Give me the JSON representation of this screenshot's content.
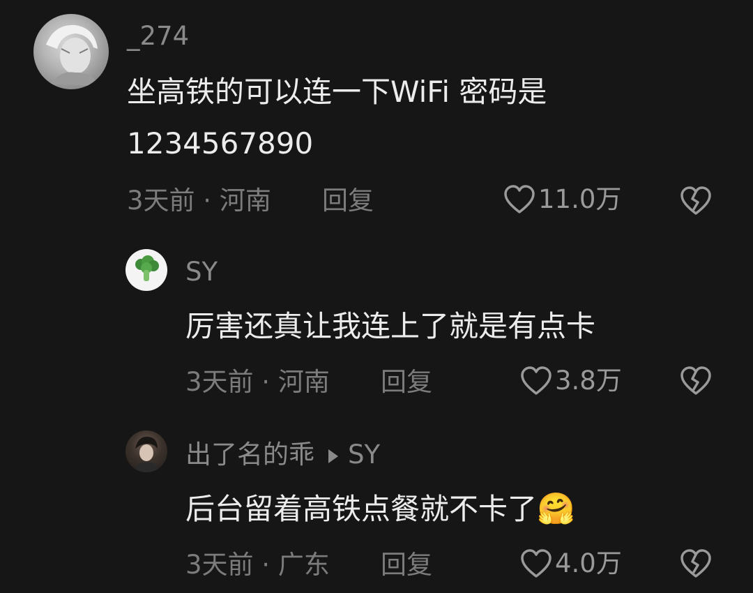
{
  "comments": [
    {
      "username": "_274",
      "content_line1": "坐高铁的可以连一下WiFi  密码是",
      "content_line2": "1234567890",
      "meta": "3天前 · 河南",
      "reply_label": "回复",
      "likes": "11.0万",
      "avatar_icon": "anime-character-avatar"
    },
    {
      "username": "SY",
      "content": "厉害还真让我连上了就是有点卡",
      "meta": "3天前 · 河南",
      "reply_label": "回复",
      "likes": "3.8万",
      "avatar_icon": "broccoli-icon"
    },
    {
      "username": "出了名的乖",
      "reply_to": "SY",
      "content": "后台留着高铁点餐就不卡了",
      "emoji": "🤗",
      "meta": "3天前 · 广东",
      "reply_label": "回复",
      "likes": "4.0万",
      "avatar_icon": "person-photo-avatar"
    }
  ],
  "colors": {
    "background": "#161616",
    "primary_text": "#ececec",
    "secondary_text": "#7c7c7c"
  }
}
